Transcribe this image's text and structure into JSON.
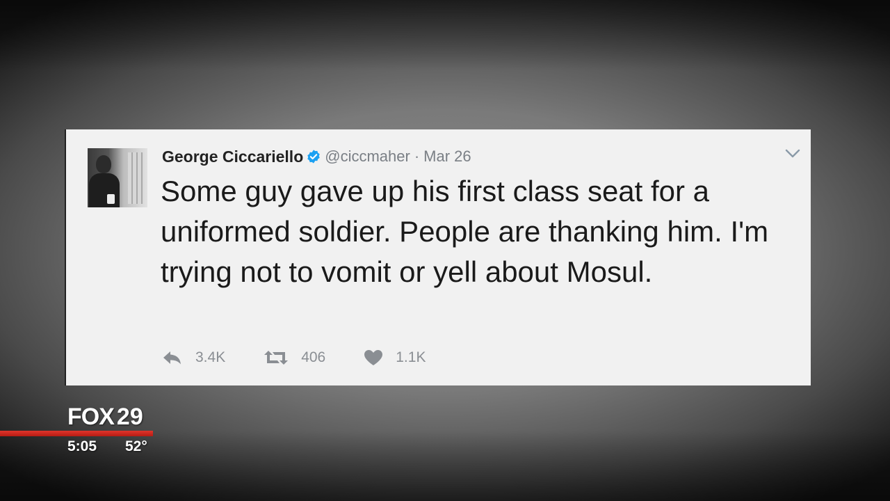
{
  "tweet": {
    "author_name": "George Ciccariello",
    "handle": "@ciccmaher",
    "separator": "·",
    "date": "Mar 26",
    "text": "Some guy gave up his first class seat for a uniformed soldier. People are thanking him. I'm trying not to vomit or yell about Mosul.",
    "verified_icon": "verified-badge-icon",
    "menu_icon": "chevron-down-icon",
    "actions": {
      "reply": {
        "icon": "reply-icon",
        "count": "3.4K"
      },
      "retweet": {
        "icon": "retweet-icon",
        "count": "406"
      },
      "like": {
        "icon": "heart-icon",
        "count": "1.1K"
      }
    }
  },
  "broadcast": {
    "station_name": "FOX",
    "station_number": "29",
    "time": "5:05",
    "temperature": "52°"
  },
  "colors": {
    "card_background": "#f1f1f1",
    "verified_blue": "#1da1f2",
    "action_gray": "#8a8e93",
    "accent_red": "#d42a20"
  }
}
